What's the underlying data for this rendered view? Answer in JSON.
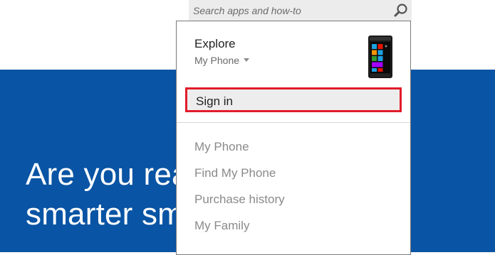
{
  "search": {
    "placeholder": "Search apps and how-to",
    "icon": "search-icon"
  },
  "hero": {
    "line1": "Are you rea",
    "line2": "smarter sm",
    "background": "#0954a4"
  },
  "dropdown": {
    "title": "Explore",
    "device_selector": "My Phone",
    "sign_in_label": "Sign in",
    "highlight_color": "#e11c2b",
    "items": [
      {
        "label": "My Phone"
      },
      {
        "label": "Find My Phone"
      },
      {
        "label": "Purchase history"
      },
      {
        "label": "My Family"
      }
    ]
  }
}
